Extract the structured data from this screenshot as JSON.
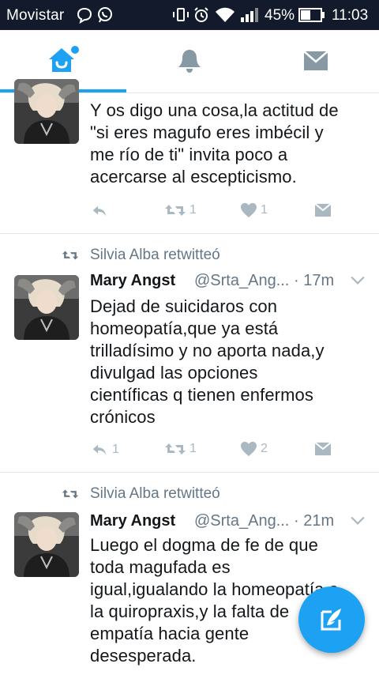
{
  "status_bar": {
    "carrier": "Movistar",
    "battery_percent": "45%",
    "time": "11:03"
  },
  "tabs": [
    {
      "icon": "home-icon",
      "active": true
    },
    {
      "icon": "notifications-bell-icon",
      "active": false
    },
    {
      "icon": "messages-envelope-icon",
      "active": false
    }
  ],
  "colors": {
    "accent": "#1da1f2",
    "status_bar": "#121a2b",
    "secondary_text": "#657786",
    "action_icons": "#aab8c2"
  },
  "tweets": [
    {
      "retweeted_by": "",
      "author_name": "",
      "handle": "",
      "time": "",
      "text_lines": [
        "Y os digo una cosa,la actitud de",
        "\"si eres magufo eres imbécil y",
        "me río de ti\" invita poco a",
        "acercarse al escepticismo."
      ],
      "reply_count": "",
      "retweet_count": "1",
      "like_count": "1"
    },
    {
      "retweeted_by": "Silvia Alba retwitteó",
      "author_name": "Mary Angst",
      "handle": "@Srta_Ang...",
      "time": "· 17m",
      "text_lines": [
        "Dejad de suicidaros con",
        "homeopatía,que ya está",
        "trilladísimo y no aporta nada,y",
        "divulgad las opciones",
        "científicas q tienen enfermos",
        "crónicos"
      ],
      "reply_count": "1",
      "retweet_count": "1",
      "like_count": "2"
    },
    {
      "retweeted_by": "Silvia Alba retwitteó",
      "author_name": "Mary Angst",
      "handle": "@Srta_Ang...",
      "time": "· 21m",
      "text_lines": [
        "Luego el dogma de fe de que",
        "toda magufada es",
        "igual,igualando la homeopatía a",
        "la quiropraxis,y la falta de",
        "empatía hacia gente",
        "desesperada."
      ]
    }
  ],
  "fab": {
    "icon": "compose-tweet-icon"
  }
}
